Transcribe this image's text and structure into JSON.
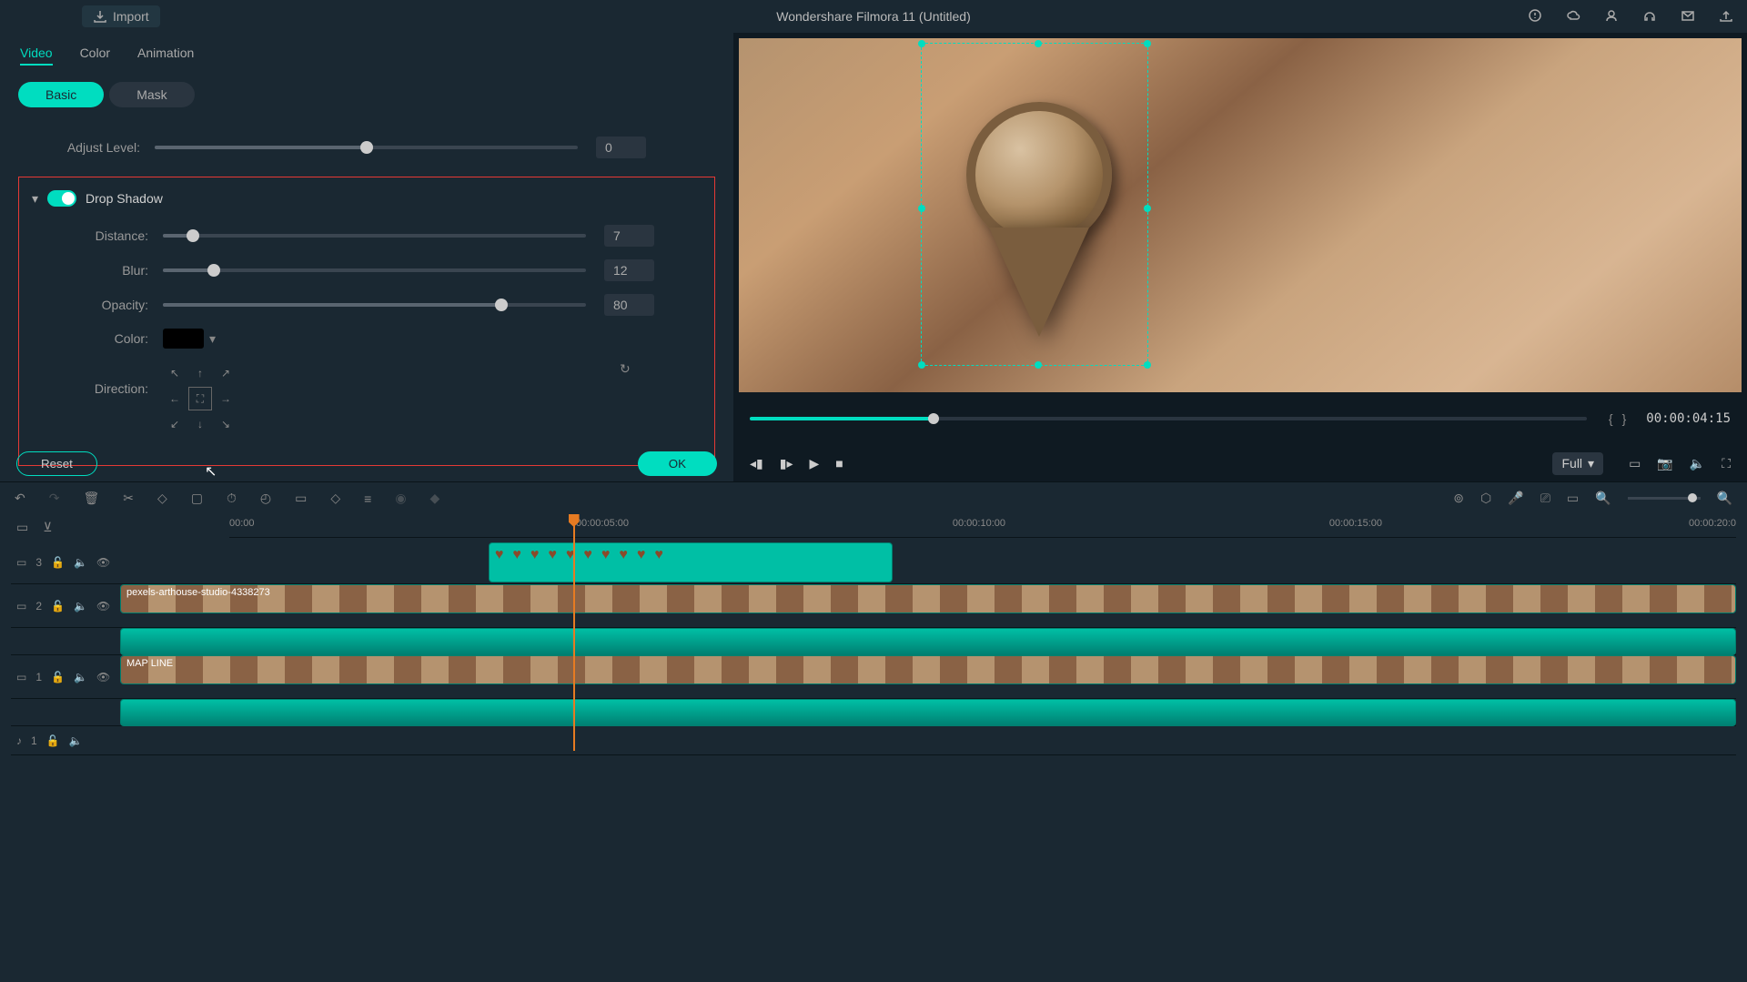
{
  "app": {
    "title": "Wondershare Filmora 11 (Untitled)",
    "import": "Import"
  },
  "tabs": {
    "video": "Video",
    "color": "Color",
    "animation": "Animation"
  },
  "subtabs": {
    "basic": "Basic",
    "mask": "Mask"
  },
  "adjust": {
    "label": "Adjust Level:",
    "value": "0"
  },
  "dropshadow": {
    "title": "Drop Shadow",
    "distance_label": "Distance:",
    "distance": "7",
    "blur_label": "Blur:",
    "blur": "12",
    "opacity_label": "Opacity:",
    "opacity": "80",
    "color_label": "Color:",
    "direction_label": "Direction:"
  },
  "buttons": {
    "reset": "Reset",
    "ok": "OK"
  },
  "player": {
    "timecode": "00:00:04:15",
    "quality": "Full"
  },
  "ruler": {
    "t0": "00:00",
    "t5": "00:00:05:00",
    "t10": "00:00:10:00",
    "t15": "00:00:15:00",
    "t20": "00:00:20:0"
  },
  "tracks": {
    "v3": "3",
    "v2": "2",
    "v1": "1",
    "a1": "1",
    "clip2_name": "pexels-arthouse-studio-4338273",
    "clip1_name": "MAP LINE"
  }
}
